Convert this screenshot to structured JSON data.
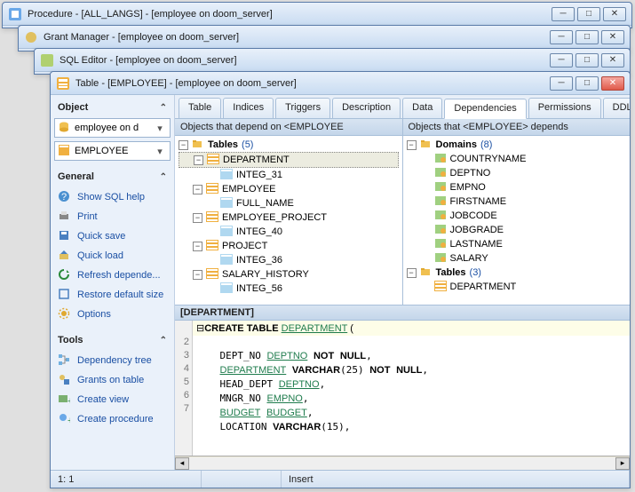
{
  "bg_windows": [
    {
      "title": "Procedure - [ALL_LANGS] - [employee on doom_server]"
    },
    {
      "title": "Grant Manager - [employee on doom_server]"
    },
    {
      "title": "SQL Editor - [employee on doom_server]"
    }
  ],
  "window": {
    "title": "Table - [EMPLOYEE] - [employee on doom_server]"
  },
  "sidebar": {
    "object": {
      "header": "Object",
      "db_combo": "employee on d",
      "obj_combo": "EMPLOYEE"
    },
    "general": {
      "header": "General",
      "items": [
        "Show SQL help",
        "Print",
        "Quick save",
        "Quick load",
        "Refresh depende...",
        "Restore default size",
        "Options"
      ]
    },
    "tools": {
      "header": "Tools",
      "items": [
        "Dependency tree",
        "Grants on table",
        "Create view",
        "Create procedure"
      ]
    }
  },
  "tabs": [
    "Table",
    "Indices",
    "Triggers",
    "Description",
    "Data",
    "Dependencies",
    "Permissions",
    "DDL"
  ],
  "active_tab": 5,
  "dep_left": {
    "header": "Objects that depend on <EMPLOYEE",
    "root": {
      "label": "Tables",
      "count": 5
    },
    "tables": [
      {
        "name": "DEPARTMENT",
        "children": [
          "INTEG_31"
        ],
        "selected": true
      },
      {
        "name": "EMPLOYEE",
        "children": [
          "FULL_NAME"
        ]
      },
      {
        "name": "EMPLOYEE_PROJECT",
        "children": [
          "INTEG_40"
        ]
      },
      {
        "name": "PROJECT",
        "children": [
          "INTEG_36"
        ]
      },
      {
        "name": "SALARY_HISTORY",
        "children": [
          "INTEG_56"
        ]
      }
    ]
  },
  "dep_right": {
    "header": "Objects that <EMPLOYEE> depends",
    "domains": {
      "label": "Domains",
      "count": 8,
      "items": [
        "COUNTRYNAME",
        "DEPTNO",
        "EMPNO",
        "FIRSTNAME",
        "JOBCODE",
        "JOBGRADE",
        "LASTNAME",
        "SALARY"
      ]
    },
    "tables": {
      "label": "Tables",
      "count": 3,
      "items": [
        "DEPARTMENT"
      ]
    }
  },
  "sql": {
    "header": "[DEPARTMENT]",
    "lines": [
      {
        "raw": "CREATE TABLE DEPARTMENT ("
      },
      {
        "raw": "    DEPT_NO DEPTNO NOT NULL,"
      },
      {
        "raw": "    DEPARTMENT VARCHAR(25) NOT NULL,"
      },
      {
        "raw": "    HEAD_DEPT DEPTNO,"
      },
      {
        "raw": "    MNGR_NO EMPNO,"
      },
      {
        "raw": "    BUDGET BUDGET,"
      },
      {
        "raw": "    LOCATION VARCHAR(15),"
      }
    ],
    "gutter": [
      "",
      "2",
      "3",
      "4",
      "5",
      "6",
      "7"
    ]
  },
  "status": {
    "pos": "1:   1",
    "mode": "Insert"
  }
}
